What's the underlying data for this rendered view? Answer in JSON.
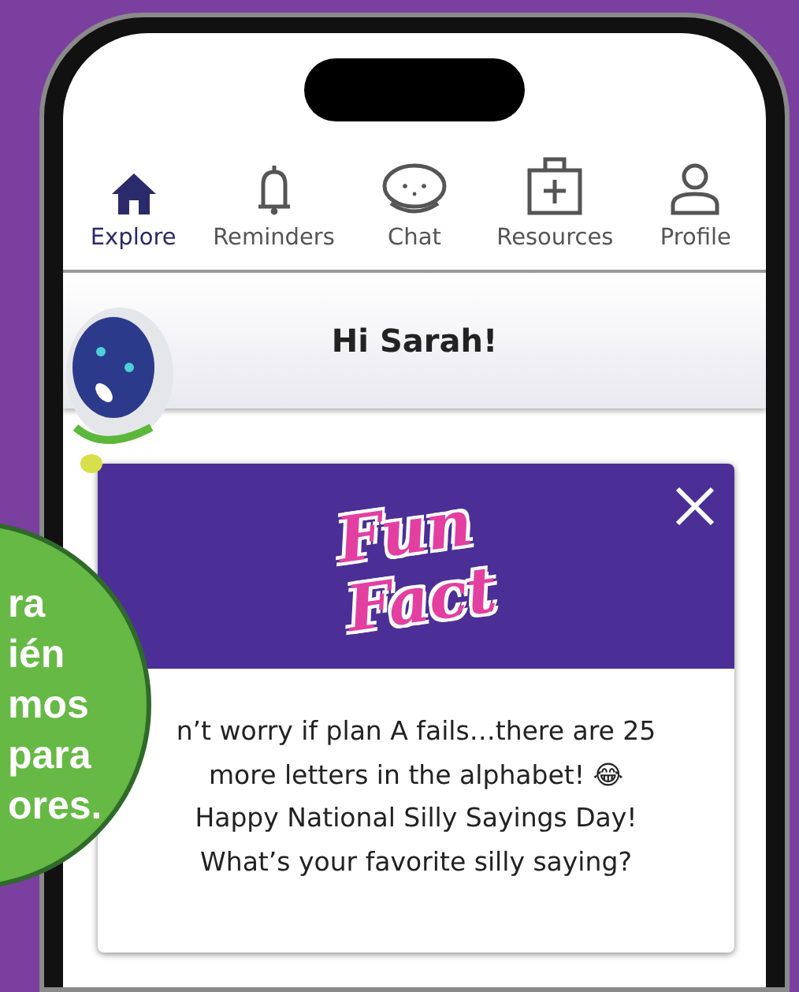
{
  "tabs": [
    {
      "label": "Explore",
      "selected": true
    },
    {
      "label": "Reminders",
      "selected": false
    },
    {
      "label": "Chat",
      "selected": false
    },
    {
      "label": "Resources",
      "selected": false
    },
    {
      "label": "Profile",
      "selected": false
    }
  ],
  "greeting": "Hi Sarah!",
  "fun_fact": {
    "logo": [
      "Fun",
      "Fact"
    ],
    "message": [
      "n’t worry if plan A fails…there are 25",
      "more letters in the alphabet! 😂",
      "Happy National Silly Sayings Day!",
      "What’s your favorite silly saying?"
    ]
  },
  "badge": {
    "lines": [
      "ra",
      "ién",
      "mos",
      "para",
      "ores."
    ]
  }
}
